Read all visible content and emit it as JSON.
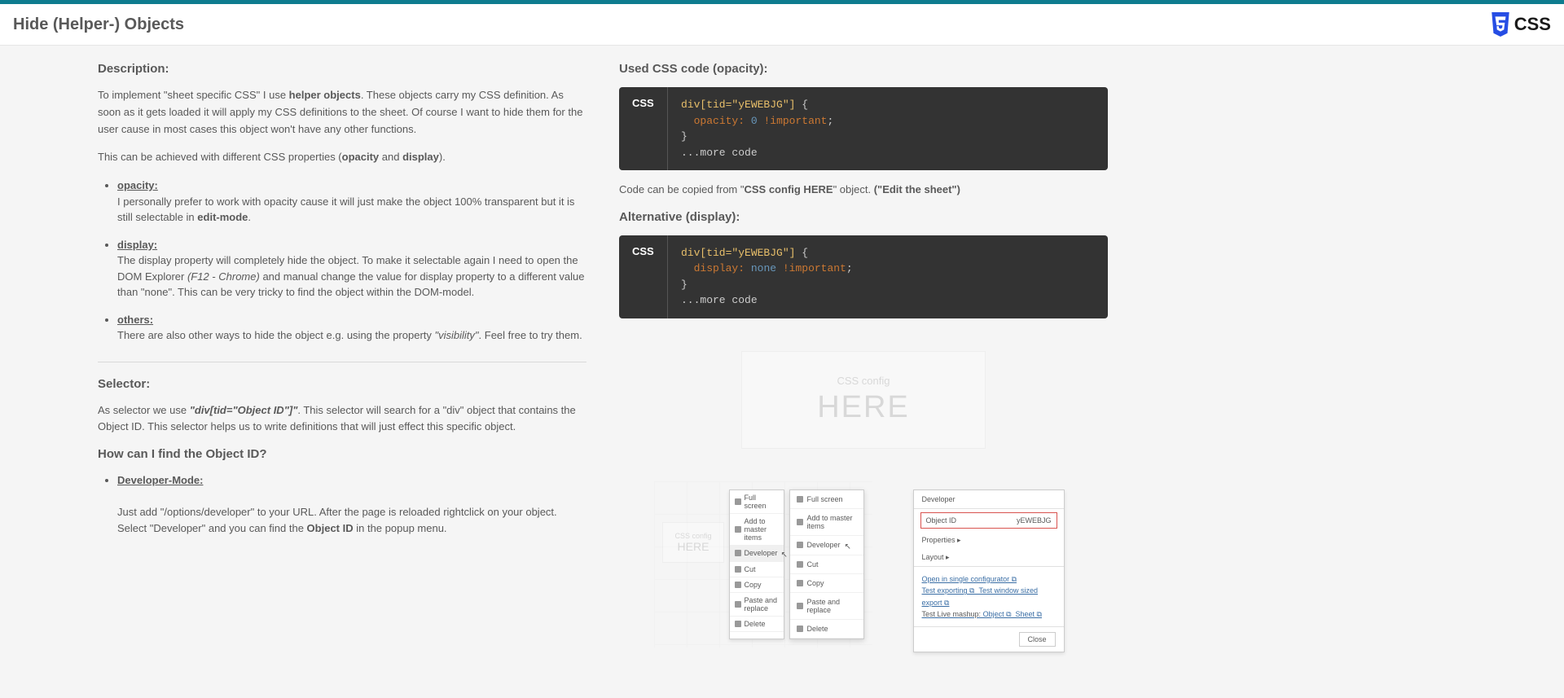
{
  "header": {
    "title": "Hide (Helper-) Objects",
    "logo_text": "CSS"
  },
  "description": {
    "heading": "Description:",
    "p1_a": "To implement \"sheet specific CSS\" I use ",
    "p1_b": "helper objects",
    "p1_c": ". These objects carry my CSS definition. As soon as it gets loaded it will apply my CSS definitions to the sheet. Of course I want to hide them for the user cause in most cases this object won't have any other functions.",
    "p2_a": "This can be achieved with different CSS properties (",
    "p2_b": "opacity",
    "p2_c": " and ",
    "p2_d": "display",
    "p2_e": ").",
    "opacity": {
      "label": "opacity:",
      "text_a": "I personally prefer to work with opacity cause it will just make the object 100% transparent but it is still selectable in ",
      "text_b": "edit-mode",
      "text_c": "."
    },
    "display": {
      "label": "display:",
      "text_a": "The display property will completely hide the object. To make it selectable again I need to open the DOM Explorer ",
      "text_b": "(F12 - Chrome)",
      "text_c": " and manual change the value for display property to a different value than \"none\". This can be very tricky to find the object within the DOM-model."
    },
    "others": {
      "label": "others:",
      "text_a": "There are also other ways to hide the object e.g. using the property ",
      "text_b": "\"visibility\"",
      "text_c": ". Feel free to try them."
    }
  },
  "selector": {
    "heading": "Selector:",
    "p1_a": "As selector we use ",
    "p1_b": "\"div[tid=\"Object ID\"]\"",
    "p1_c": ". This selector will search for a \"div\" object that contains the Object ID. This selector helps us to write definitions that will just effect this specific object."
  },
  "find_id": {
    "heading": "How can I find the Object ID?",
    "dev_label": "Developer-Mode:",
    "dev_text_a": "Just add \"/options/developer\" to your URL. After the page is reloaded rightclick on your object. Select \"Developer\" and you can find the ",
    "dev_text_b": "Object ID",
    "dev_text_c": " in the popup menu."
  },
  "right": {
    "heading1": "Used CSS code (opacity):",
    "code1": {
      "lang": "CSS",
      "selector": "div[tid=\"yEWEBJG\"]",
      "brace_open": " {",
      "prop": "opacity:",
      "val": "0",
      "imp": "!important",
      "semi": ";",
      "brace_close": "}",
      "more": "...more code"
    },
    "copy_a": "Code can be copied from \"",
    "copy_b": "CSS config HERE",
    "copy_c": "\" object. ",
    "copy_d": "(\"Edit the sheet\")",
    "heading2": "Alternative (display):",
    "code2": {
      "lang": "CSS",
      "selector": "div[tid=\"yEWEBJG\"]",
      "brace_open": " {",
      "prop": "display:",
      "val": "none",
      "imp": "!important",
      "semi": ";",
      "brace_close": "}",
      "more": "...more code"
    },
    "config_box": {
      "small": "CSS config",
      "big": "HERE"
    },
    "ctx_small": {
      "i1": "Full screen",
      "i2": "Add to master items",
      "i3": "Developer",
      "i4": "Cut",
      "i5": "Copy",
      "i6": "Paste and replace",
      "i7": "Delete"
    },
    "ctx_large": {
      "i1": "Full screen",
      "i2": "Add to master items",
      "i3": "Developer",
      "i4": "Cut",
      "i5": "Copy",
      "i6": "Paste and replace",
      "i7": "Delete"
    },
    "dev_panel": {
      "title": "Developer",
      "objid_label": "Object ID",
      "objid_value": "yEWEBJG",
      "props": "Properties  ▸",
      "layout": "Layout  ▸",
      "link1": "Open in single configurator ⧉",
      "link2_a": "Test exporting ⧉",
      "link2_b": "Test window sized export ⧉",
      "link3_a": "Test Live mashup: ",
      "link3_b": "Object ⧉",
      "link3_c": "Sheet ⧉",
      "close": "Close"
    }
  }
}
